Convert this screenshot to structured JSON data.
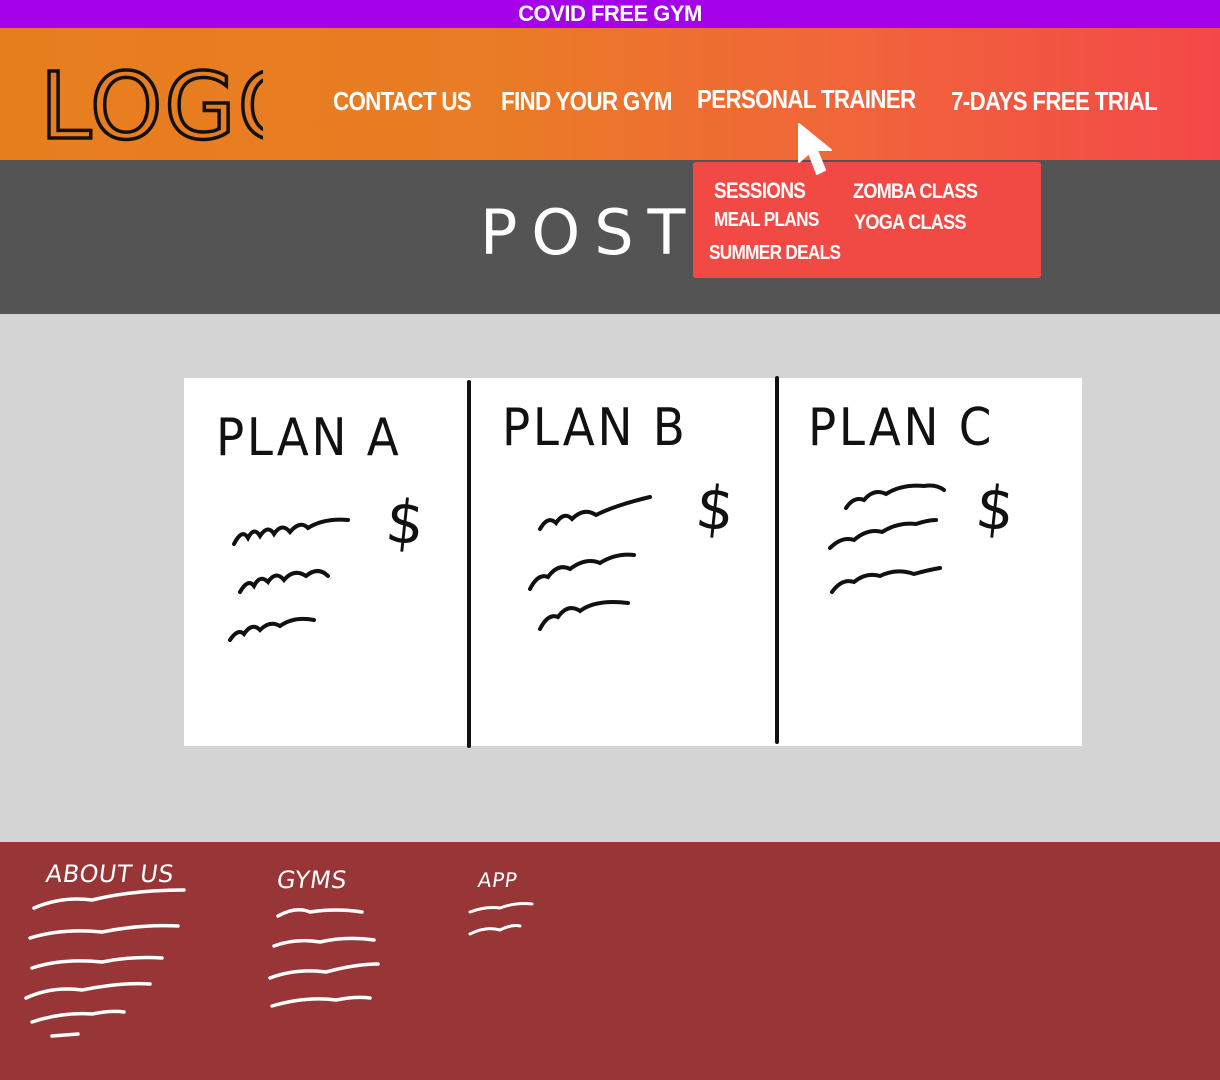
{
  "banner": {
    "text": "COVID FREE GYM"
  },
  "header": {
    "logo_text": "LOGO",
    "nav": [
      {
        "label": "CONTACT US"
      },
      {
        "label": "FIND YOUR GYM"
      },
      {
        "label": "PERSONAL TRAINER"
      },
      {
        "label": "7-DAYS  FREE TRIAL"
      }
    ]
  },
  "dropdown": {
    "items": [
      "SESSIONS",
      "MEAL PLANS",
      "SUMMER DEALS",
      "ZOMBA CLASS",
      "YOGA CLASS"
    ]
  },
  "poster": {
    "text": "POSTER"
  },
  "plans": [
    {
      "title": "PLAN  A",
      "price_symbol": "$"
    },
    {
      "title": "PLAN B",
      "price_symbol": "$"
    },
    {
      "title": "PLAN  C",
      "price_symbol": "$"
    }
  ],
  "footer": {
    "columns": [
      {
        "title": "ABOUT US"
      },
      {
        "title": "GYMS"
      },
      {
        "title": "APP"
      }
    ]
  },
  "colors": {
    "banner": "#a602ea",
    "header_start": "#e77e1e",
    "header_end": "#f34848",
    "poster_bg": "#545454",
    "dropdown_bg": "#f14a45",
    "page_bg": "#d4d4d4",
    "footer_bg": "#983536"
  },
  "icons": {
    "cursor": "mouse-pointer-icon"
  }
}
